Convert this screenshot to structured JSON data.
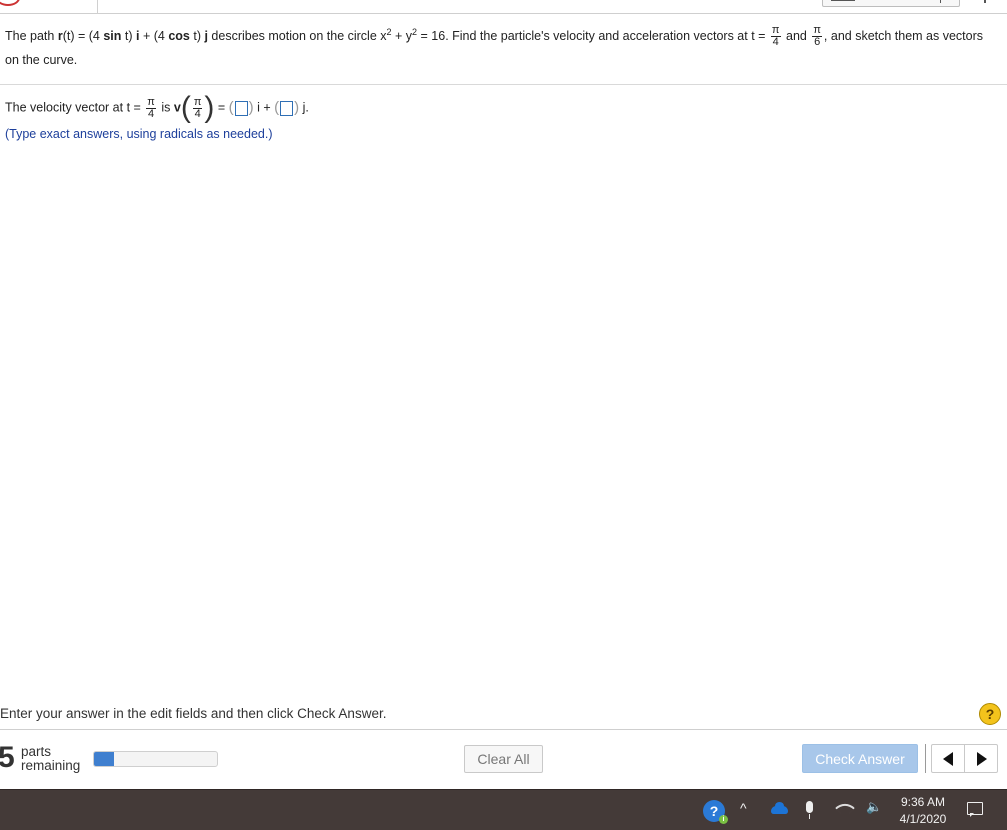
{
  "question": {
    "p1": "The path ",
    "r_bold": "r",
    "p2": "(t) = (4 ",
    "sin_bold": "sin",
    "p3": " t) ",
    "i_bold": "i",
    "p4": " + (4 ",
    "cos_bold": "cos",
    "p5": " t) ",
    "j_bold": "j",
    "p6": " describes motion on the circle x",
    "exp1": "2",
    "p7": " + y",
    "exp2": "2",
    "p8": " = 16. Find the particle's velocity and acceleration vectors at t = ",
    "frac1_num": "π",
    "frac1_den": "4",
    "p9": " and ",
    "frac2_num": "π",
    "frac2_den": "6",
    "p10": ", and sketch them as vectors on the curve."
  },
  "answer": {
    "prefix": "The velocity vector at t = ",
    "frac_num": "π",
    "frac_den": "4",
    "is_text": " is ",
    "v_bold": "v",
    "inner_num": "π",
    "inner_den": "4",
    "equals": " = ",
    "i_label": " i + ",
    "j_label": " j."
  },
  "hint": "(Type exact answers, using radicals as needed.)",
  "footer": {
    "instruction": "Enter your answer in the edit fields and then click Check Answer.",
    "help_symbol": "?",
    "parts_count": "5",
    "parts_label_1": "parts",
    "parts_label_2": "remaining",
    "progress_fraction": 0.16,
    "clear_all": "Clear All",
    "check_answer": "Check Answer"
  },
  "taskbar": {
    "help_symbol": "?",
    "badge": "i",
    "chevron": "^",
    "volume_symbol": "🔈",
    "time": "9:36 AM",
    "date": "4/1/2020"
  },
  "colors": {
    "check_button": "#a8c7ea",
    "progress_fill": "#3f7fcf",
    "hint_text": "#1d3f9b",
    "help_badge": "#f3c31c",
    "taskbar": "#443a38"
  }
}
